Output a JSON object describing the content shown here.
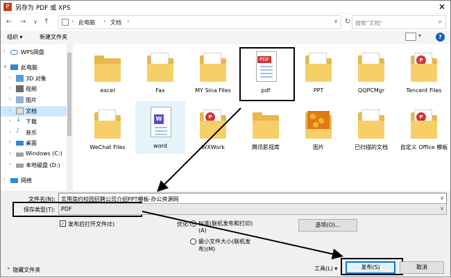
{
  "window": {
    "title": "另存为 PDF 或 XPS",
    "app_icon": "powerpoint-icon",
    "close_glyph": "✕"
  },
  "nav": {
    "back": "←",
    "forward": "→",
    "dropdown": "∨",
    "up": "↑",
    "breadcrumbs": [
      "此电脑",
      "文档"
    ],
    "search_placeholder": "搜索\"文档\""
  },
  "toolbar": {
    "organize": "组织 ▾",
    "new_folder": "新建文件夹",
    "help": "?"
  },
  "sidebar": {
    "items": [
      {
        "label": "WPS网盘",
        "icon": "cloud-icon"
      },
      {
        "label": "此电脑",
        "icon": "computer-icon"
      },
      {
        "label": "3D 对象",
        "icon": "3d-objects-icon"
      },
      {
        "label": "视频",
        "icon": "video-icon"
      },
      {
        "label": "图片",
        "icon": "pictures-icon"
      },
      {
        "label": "文档",
        "icon": "documents-icon"
      },
      {
        "label": "下载",
        "icon": "download-icon"
      },
      {
        "label": "音乐",
        "icon": "music-icon"
      },
      {
        "label": "桌面",
        "icon": "desktop-icon"
      },
      {
        "label": "Windows (C:)",
        "icon": "drive-icon"
      },
      {
        "label": "本地磁盘 (D:)",
        "icon": "drive-icon"
      },
      {
        "label": "网络",
        "icon": "network-icon"
      }
    ]
  },
  "files": {
    "row1": [
      "excel",
      "Fax",
      "MY Sina Files",
      "pdf",
      "PPT",
      "QQPCMgr",
      "Tencent Files"
    ],
    "row2": [
      "WeChat Files",
      "word",
      "WXWork",
      "腾讯影视库",
      "图片",
      "已扫描的文档",
      "自定义 Office 模板"
    ]
  },
  "form": {
    "filename_label": "文件名(N):",
    "filename_value": "实用简约校园招聘公司介绍PPT模板-办公资源网",
    "type_label": "保存类型(T):",
    "type_value": "PDF",
    "open_after_publish": "发布后打开文件(E)",
    "optimize_label": "优化:",
    "opt_standard": "标准(联机发布和打印)",
    "opt_standard_key": "(A)",
    "opt_min_1": "最小文件大小(联机发",
    "opt_min_2": "布)(M)",
    "options_button": "选项(O)...",
    "hide_folders": "隐藏文件夹",
    "tools": "工具(L)",
    "publish": "发布(S)",
    "cancel": "取消"
  }
}
